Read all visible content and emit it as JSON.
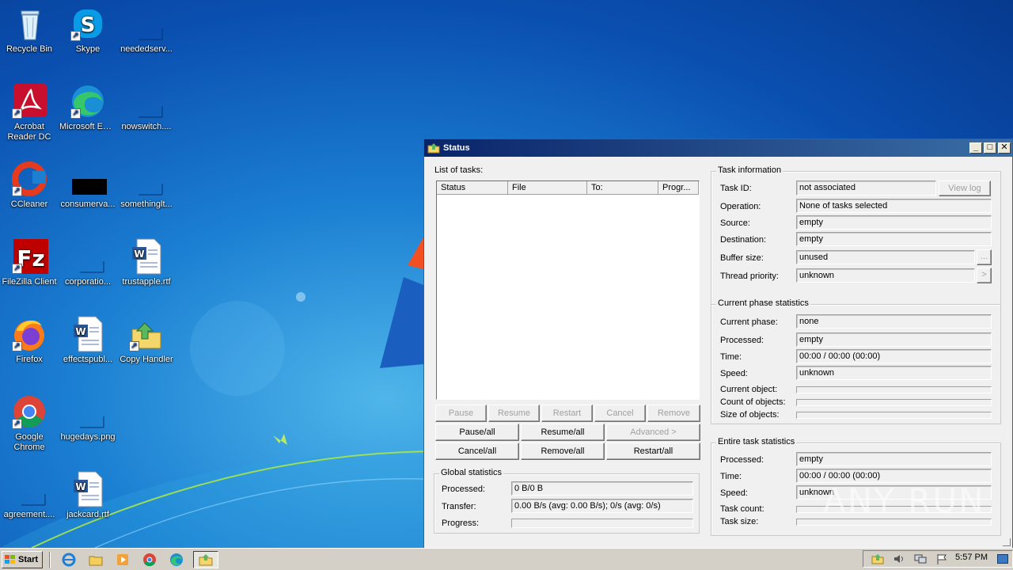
{
  "desktop": {
    "icons": [
      {
        "label": "Recycle Bin"
      },
      {
        "label": "Skype"
      },
      {
        "label": "neededserv..."
      },
      {
        "label": "Acrobat Reader DC"
      },
      {
        "label": "Microsoft Edge"
      },
      {
        "label": "nowswitch...."
      },
      {
        "label": "CCleaner"
      },
      {
        "label": "consumerva..."
      },
      {
        "label": "somethinglt..."
      },
      {
        "label": "FileZilla Client"
      },
      {
        "label": "corporatio..."
      },
      {
        "label": "trustapple.rtf"
      },
      {
        "label": "Firefox"
      },
      {
        "label": "effectspubl..."
      },
      {
        "label": "Copy Handler"
      },
      {
        "label": "Google Chrome"
      },
      {
        "label": "hugedays.png"
      },
      {
        "label": "agreement...."
      },
      {
        "label": "jackcard.rtf"
      }
    ]
  },
  "window": {
    "title": "Status",
    "controls": {
      "minimize": "_",
      "maximize": "□",
      "close": "✕"
    },
    "task_list": {
      "label": "List of tasks:",
      "columns": [
        "Status",
        "File",
        "To:",
        "Progr..."
      ],
      "rows": []
    },
    "buttons_row1": [
      "Pause",
      "Resume",
      "Restart",
      "Cancel",
      "Remove"
    ],
    "buttons_row2": [
      "Pause/all",
      "Resume/all",
      "Advanced >"
    ],
    "buttons_row3": [
      "Cancel/all",
      "Remove/all",
      "Restart/all"
    ],
    "global_stats": {
      "title": "Global statistics",
      "processed_label": "Processed:",
      "processed_value": "0 B/0 B",
      "transfer_label": "Transfer:",
      "transfer_value": "0.00 B/s (avg: 0.00 B/s); 0/s (avg: 0/s)",
      "progress_label": "Progress:",
      "progress": 0
    },
    "task_info": {
      "title": "Task information",
      "task_id_label": "Task ID:",
      "task_id_value": "not associated",
      "view_log": "View log",
      "operation_label": "Operation:",
      "operation_value": "None of tasks selected",
      "source_label": "Source:",
      "source_value": "empty",
      "destination_label": "Destination:",
      "destination_value": "empty",
      "buffer_label": "Buffer size:",
      "buffer_value": "unused",
      "buffer_btn": "...",
      "priority_label": "Thread priority:",
      "priority_value": "unknown",
      "priority_btn": ">"
    },
    "phase_stats": {
      "title": "Current phase statistics",
      "phase_label": "Current phase:",
      "phase_value": "none",
      "processed_label": "Processed:",
      "processed_value": "empty",
      "time_label": "Time:",
      "time_value": "00:00 / 00:00 (00:00)",
      "speed_label": "Speed:",
      "speed_value": "unknown",
      "current_object_label": "Current object:",
      "count_objects_label": "Count of objects:",
      "size_objects_label": "Size of objects:"
    },
    "entire_stats": {
      "title": "Entire task statistics",
      "processed_label": "Processed:",
      "processed_value": "empty",
      "time_label": "Time:",
      "time_value": "00:00 / 00:00 (00:00)",
      "speed_label": "Speed:",
      "speed_value": "unknown",
      "task_count_label": "Task count:",
      "task_size_label": "Task size:"
    }
  },
  "taskbar": {
    "start_label": "Start",
    "clock": "5:57 PM"
  },
  "watermark": "ANY RUN"
}
